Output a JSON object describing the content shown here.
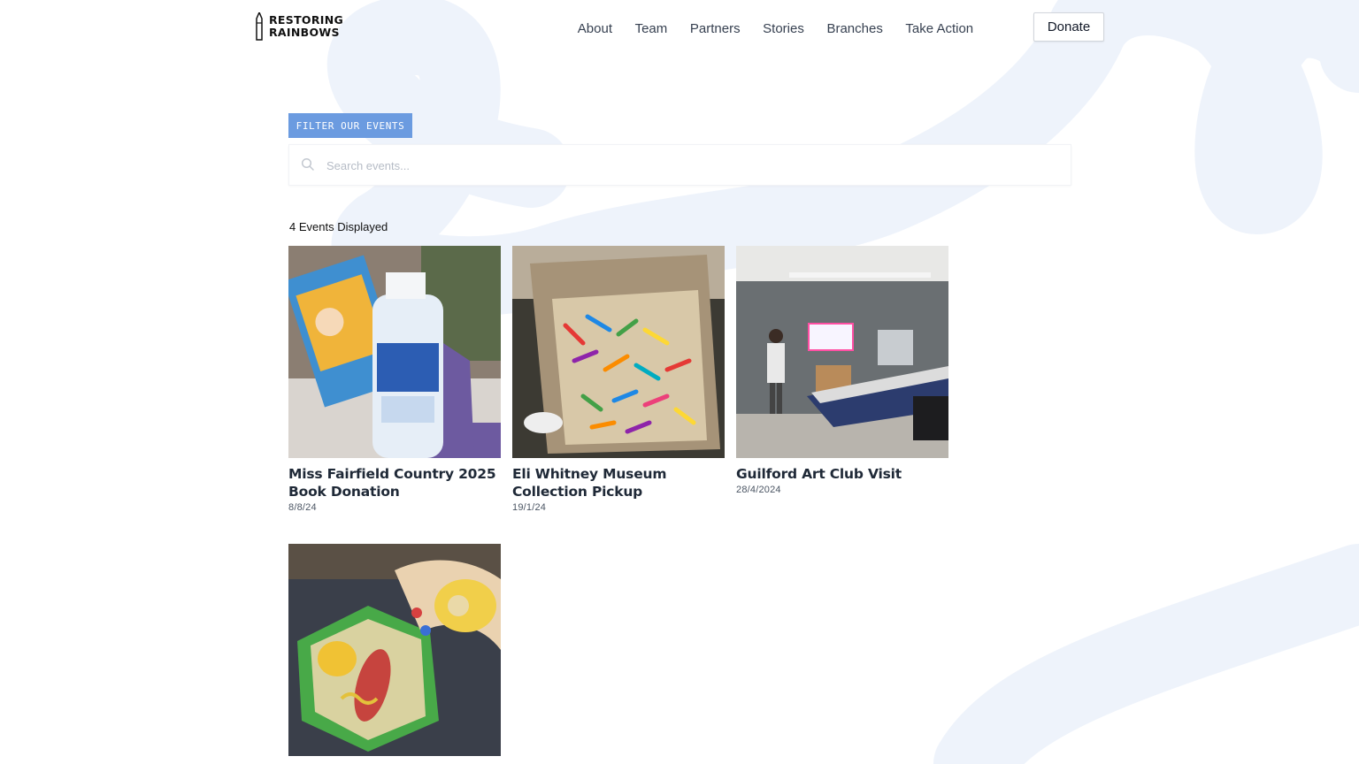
{
  "brand": {
    "line1": "RESTORING",
    "line2": "RAINBOWS"
  },
  "nav": [
    {
      "label": "About"
    },
    {
      "label": "Team"
    },
    {
      "label": "Partners"
    },
    {
      "label": "Stories"
    },
    {
      "label": "Branches"
    },
    {
      "label": "Take Action"
    }
  ],
  "donate_label": "Donate",
  "filter": {
    "tab_label": "FILTER OUR EVENTS",
    "search_placeholder": "Search events...",
    "search_value": ""
  },
  "events_count_label": "4 Events Displayed",
  "events": [
    {
      "title": "Miss Fairfield Country 2025 Book Donation",
      "date": "8/8/24",
      "image": "book-and-disinfectant-photo"
    },
    {
      "title": "Eli Whitney Museum Collection Pickup",
      "date": "19/1/24",
      "image": "box-of-markers-photo"
    },
    {
      "title": "Guilford Art Club Visit",
      "date": "28/4/2024",
      "image": "art-club-classroom-photo"
    },
    {
      "title": "",
      "date": "",
      "image": "plant-cell-model-photo"
    }
  ],
  "colors": {
    "accent": "#6b9be0",
    "swirl": "#eef3fb",
    "text": "#1f2937"
  }
}
